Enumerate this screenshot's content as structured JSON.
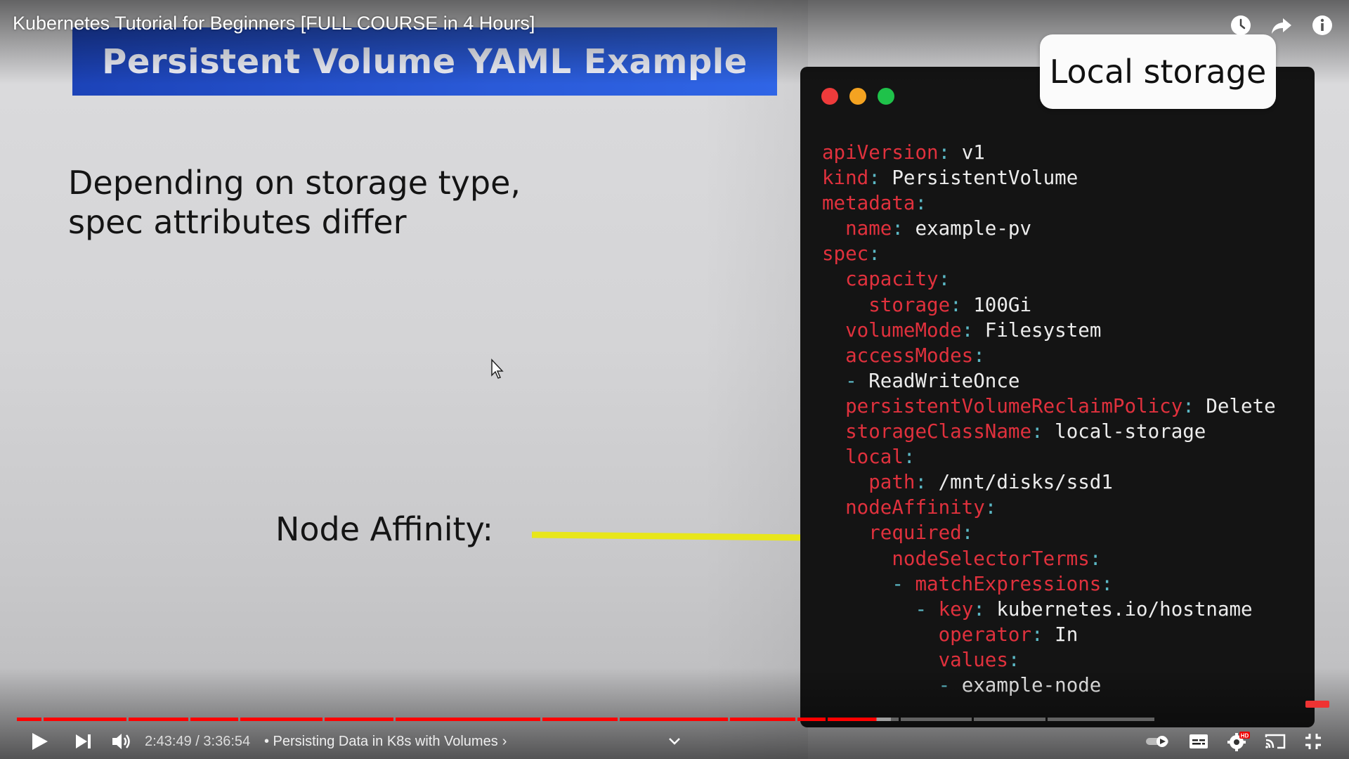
{
  "video": {
    "title": "Kubernetes Tutorial for Beginners [FULL COURSE in 4 Hours]",
    "current_time": "2:43:49",
    "separator": " / ",
    "duration": "3:36:54",
    "chapter": "• Persisting Data in K8s with Volumes",
    "chapter_chevron": "›",
    "progress_fraction": 0.755,
    "buffered_fraction": 0.768
  },
  "top_icons": [
    "watch-later-icon",
    "share-icon",
    "info-icon"
  ],
  "slide": {
    "banner_title": "Persistent Volume YAML Example",
    "text_line1": "Depending on storage type,",
    "text_line2": "spec attributes differ",
    "node_affinity": "Node Affinity:"
  },
  "storage_label": "Local storage",
  "code_lines": [
    [
      {
        "t": "apiVersion",
        "c": "k"
      },
      {
        "t": ":",
        "c": "p"
      },
      {
        "t": " v1",
        "c": "v"
      }
    ],
    [
      {
        "t": "kind",
        "c": "k"
      },
      {
        "t": ":",
        "c": "p"
      },
      {
        "t": " PersistentVolume",
        "c": "v"
      }
    ],
    [
      {
        "t": "metadata",
        "c": "k"
      },
      {
        "t": ":",
        "c": "p"
      }
    ],
    [
      {
        "t": "  name",
        "c": "k"
      },
      {
        "t": ":",
        "c": "p"
      },
      {
        "t": " example-pv",
        "c": "v"
      }
    ],
    [
      {
        "t": "spec",
        "c": "k"
      },
      {
        "t": ":",
        "c": "p"
      }
    ],
    [
      {
        "t": "  capacity",
        "c": "k"
      },
      {
        "t": ":",
        "c": "p"
      }
    ],
    [
      {
        "t": "    storage",
        "c": "k"
      },
      {
        "t": ":",
        "c": "p"
      },
      {
        "t": " 100Gi",
        "c": "v"
      }
    ],
    [
      {
        "t": "  volumeMode",
        "c": "k"
      },
      {
        "t": ":",
        "c": "p"
      },
      {
        "t": " Filesystem",
        "c": "v"
      }
    ],
    [
      {
        "t": "  accessModes",
        "c": "k"
      },
      {
        "t": ":",
        "c": "p"
      }
    ],
    [
      {
        "t": "  - ",
        "c": "p"
      },
      {
        "t": "ReadWriteOnce",
        "c": "v"
      }
    ],
    [
      {
        "t": "  persistentVolumeReclaimPolicy",
        "c": "k"
      },
      {
        "t": ":",
        "c": "p"
      },
      {
        "t": " Delete",
        "c": "v"
      }
    ],
    [
      {
        "t": "  storageClassName",
        "c": "k"
      },
      {
        "t": ":",
        "c": "p"
      },
      {
        "t": " local-storage",
        "c": "v"
      }
    ],
    [
      {
        "t": "  local",
        "c": "k"
      },
      {
        "t": ":",
        "c": "p"
      }
    ],
    [
      {
        "t": "    path",
        "c": "k"
      },
      {
        "t": ":",
        "c": "p"
      },
      {
        "t": " /mnt/disks/ssd1",
        "c": "v"
      }
    ],
    [
      {
        "t": "  nodeAffinity",
        "c": "k"
      },
      {
        "t": ":",
        "c": "p"
      }
    ],
    [
      {
        "t": "    required",
        "c": "k"
      },
      {
        "t": ":",
        "c": "p"
      }
    ],
    [
      {
        "t": "      nodeSelectorTerms",
        "c": "k"
      },
      {
        "t": ":",
        "c": "p"
      }
    ],
    [
      {
        "t": "      - ",
        "c": "p"
      },
      {
        "t": "matchExpressions",
        "c": "k"
      },
      {
        "t": ":",
        "c": "p"
      }
    ],
    [
      {
        "t": "        - ",
        "c": "p"
      },
      {
        "t": "key",
        "c": "k"
      },
      {
        "t": ":",
        "c": "p"
      },
      {
        "t": " kubernetes.io/hostname",
        "c": "v"
      }
    ],
    [
      {
        "t": "          operator",
        "c": "k"
      },
      {
        "t": ":",
        "c": "p"
      },
      {
        "t": " In",
        "c": "v"
      }
    ],
    [
      {
        "t": "          values",
        "c": "k"
      },
      {
        "t": ":",
        "c": "p"
      }
    ],
    [
      {
        "t": "          - ",
        "c": "p"
      },
      {
        "t": "example-node",
        "c": "v"
      }
    ]
  ],
  "window_dots": [
    "#ee3b3b",
    "#f4a321",
    "#1fc24a"
  ],
  "colors": {
    "progress_played": "#ff0000",
    "arrow": "#e8e61a",
    "banner": "#2a5ad8",
    "code_key": "#e0313d",
    "code_punct": "#5bb8c5"
  },
  "controls": [
    "play-icon",
    "next-icon",
    "volume-icon",
    "chapter-dropdown-icon",
    "autoplay-toggle-icon",
    "subtitles-icon",
    "settings-hd-icon",
    "cast-icon",
    "exit-fullscreen-icon"
  ]
}
